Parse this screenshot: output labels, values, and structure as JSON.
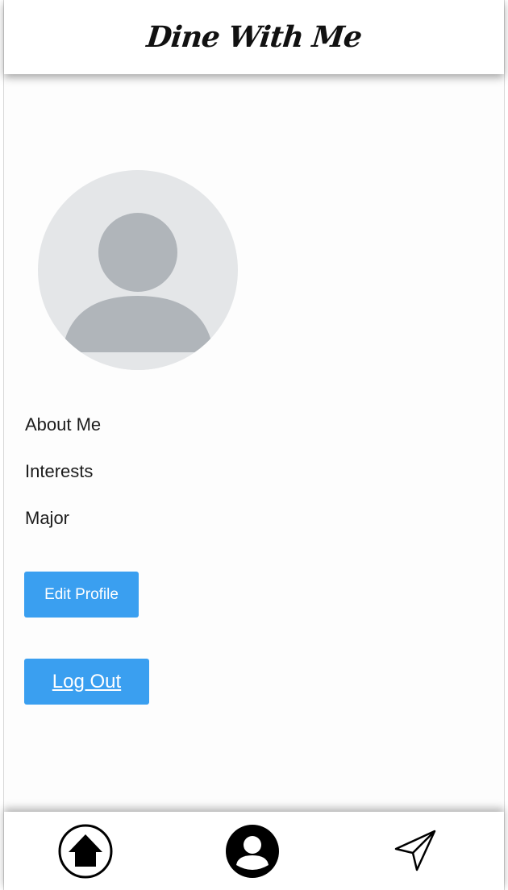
{
  "header": {
    "title": "Dine With Me"
  },
  "profile": {
    "avatar_icon": "default-avatar-icon",
    "fields": [
      {
        "label": "About Me"
      },
      {
        "label": "Interests"
      },
      {
        "label": "Major"
      }
    ],
    "edit_label": "Edit Profile",
    "logout_label": "Log Out"
  },
  "nav": {
    "items": [
      {
        "icon": "home-icon"
      },
      {
        "icon": "profile-icon"
      },
      {
        "icon": "send-icon"
      }
    ]
  },
  "colors": {
    "accent": "#3a9ff0",
    "avatar_bg": "#e4e6e8",
    "avatar_fg": "#b0b5ba"
  }
}
